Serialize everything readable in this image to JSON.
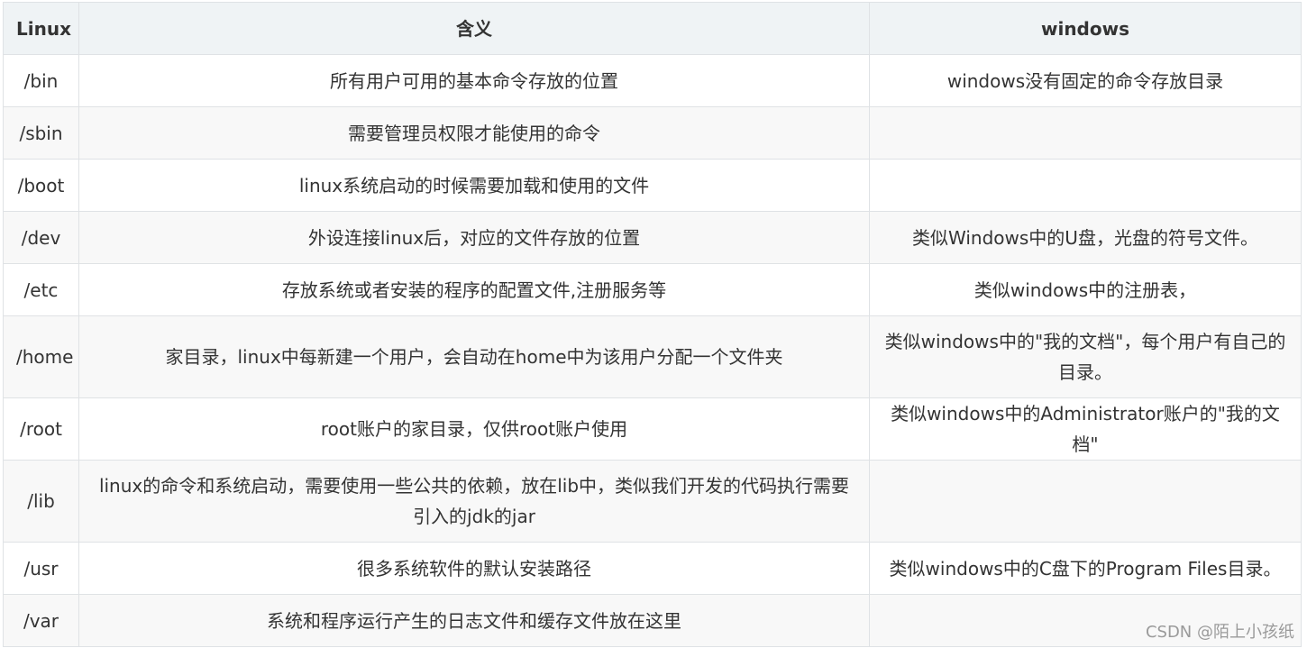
{
  "table": {
    "headers": [
      "Linux",
      "含义",
      "windows"
    ],
    "rows": [
      {
        "linux": "/bin",
        "meaning": "所有用户可用的基本命令存放的位置",
        "windows": "windows没有固定的命令存放目录"
      },
      {
        "linux": "/sbin",
        "meaning": "需要管理员权限才能使用的命令",
        "windows": ""
      },
      {
        "linux": "/boot",
        "meaning": "linux系统启动的时候需要加载和使用的文件",
        "windows": ""
      },
      {
        "linux": "/dev",
        "meaning": "外设连接linux后，对应的文件存放的位置",
        "windows": "类似Windows中的U盘，光盘的符号文件。"
      },
      {
        "linux": "/etc",
        "meaning": "存放系统或者安装的程序的配置文件,注册服务等",
        "windows": "类似windows中的注册表，"
      },
      {
        "linux": "/home",
        "meaning": "家目录，linux中每新建一个用户，会自动在home中为该用户分配一个文件夹",
        "windows": "类似windows中的\"我的文档\"，每个用户有自己的目录。"
      },
      {
        "linux": "/root",
        "meaning": "root账户的家目录，仅供root账户使用",
        "windows": "类似windows中的Administrator账户的\"我的文档\""
      },
      {
        "linux": "/lib",
        "meaning": "linux的命令和系统启动，需要使用一些公共的依赖，放在lib中，类似我们开发的代码执行需要引入的jdk的jar",
        "windows": ""
      },
      {
        "linux": "/usr",
        "meaning": "很多系统软件的默认安装路径",
        "windows": "类似windows中的C盘下的Program Files目录。"
      },
      {
        "linux": "/var",
        "meaning": "系统和程序运行产生的日志文件和缓存文件放在这里",
        "windows": ""
      }
    ]
  },
  "watermark": "CSDN @陌上小孩纸"
}
